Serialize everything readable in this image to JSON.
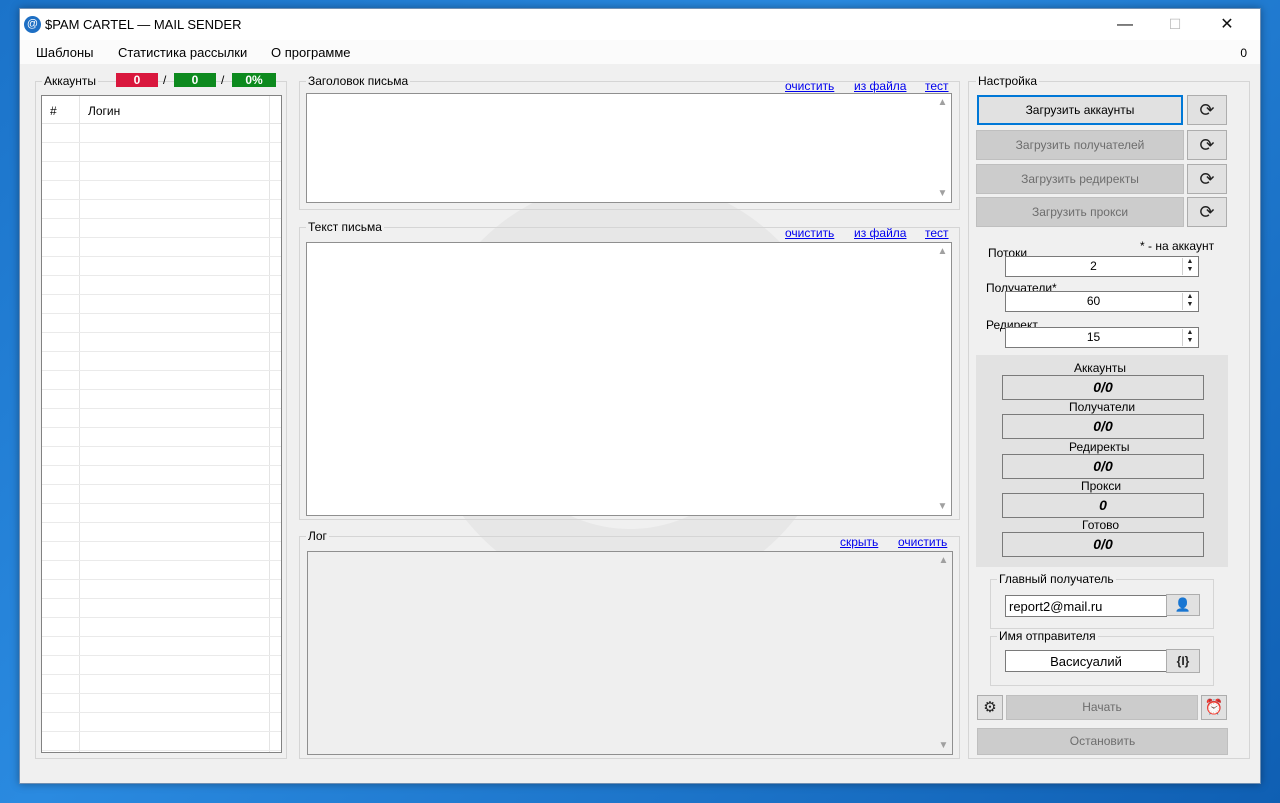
{
  "window": {
    "title": "$PAM CARTEL  — MAIL SENDER",
    "icon": "at-sign-icon",
    "min_glyph": "—",
    "max_glyph": "☐",
    "close_glyph": "✕"
  },
  "menu": {
    "items": [
      "Шаблоны",
      "Статистика рассылки",
      "О программе"
    ],
    "counter": "0"
  },
  "accounts": {
    "title": "Аккаунты",
    "badge_bad": "0",
    "badge_good": "0",
    "badge_percent": "0%",
    "separator": "/",
    "columns": [
      "#",
      "Логин"
    ],
    "colors": {
      "bad": "#d9173d",
      "good": "#0d8a1e"
    }
  },
  "subject": {
    "title": "Заголовок письма",
    "links": {
      "clear": "очистить",
      "from_file": "из файла",
      "test": "тест"
    },
    "value": ""
  },
  "body": {
    "title": "Текст письма",
    "links": {
      "clear": "очистить",
      "from_file": "из файла",
      "test": "тест"
    },
    "value": ""
  },
  "log": {
    "title": "Лог",
    "links": {
      "hide": "скрыть",
      "clear": "очистить"
    }
  },
  "settings": {
    "title": "Настройка",
    "load_accounts": "Загрузить аккаунты",
    "load_recipients": "Загрузить получателей",
    "load_redirects": "Загрузить редиректы",
    "load_proxy": "Загрузить прокси",
    "refresh_icon": "refresh-icon",
    "per_account_note": "* - на аккаунт",
    "threads_label": "Потоки",
    "threads_value": "2",
    "recipients_label": "Получатели*",
    "recipients_value": "60",
    "redirect_label": "Редирект",
    "redirect_value": "15"
  },
  "stats": [
    {
      "label": "Аккаунты",
      "value": "0/0"
    },
    {
      "label": "Получатели",
      "value": "0/0"
    },
    {
      "label": "Редиректы",
      "value": "0/0"
    },
    {
      "label": "Прокси",
      "value": "0"
    },
    {
      "label": "Готово",
      "value": "0/0"
    }
  ],
  "main_recipient": {
    "title": "Главный получатель",
    "value": "report2@mail.ru",
    "icon": "user-icon"
  },
  "sender_name": {
    "title": "Имя отправителя",
    "value": "Васисуалий",
    "macro_button": "{I}"
  },
  "actions": {
    "start": "Начать",
    "stop": "Остановить",
    "gear_icon": "gear-icon",
    "alarm_icon": "alarm-clock-icon"
  }
}
